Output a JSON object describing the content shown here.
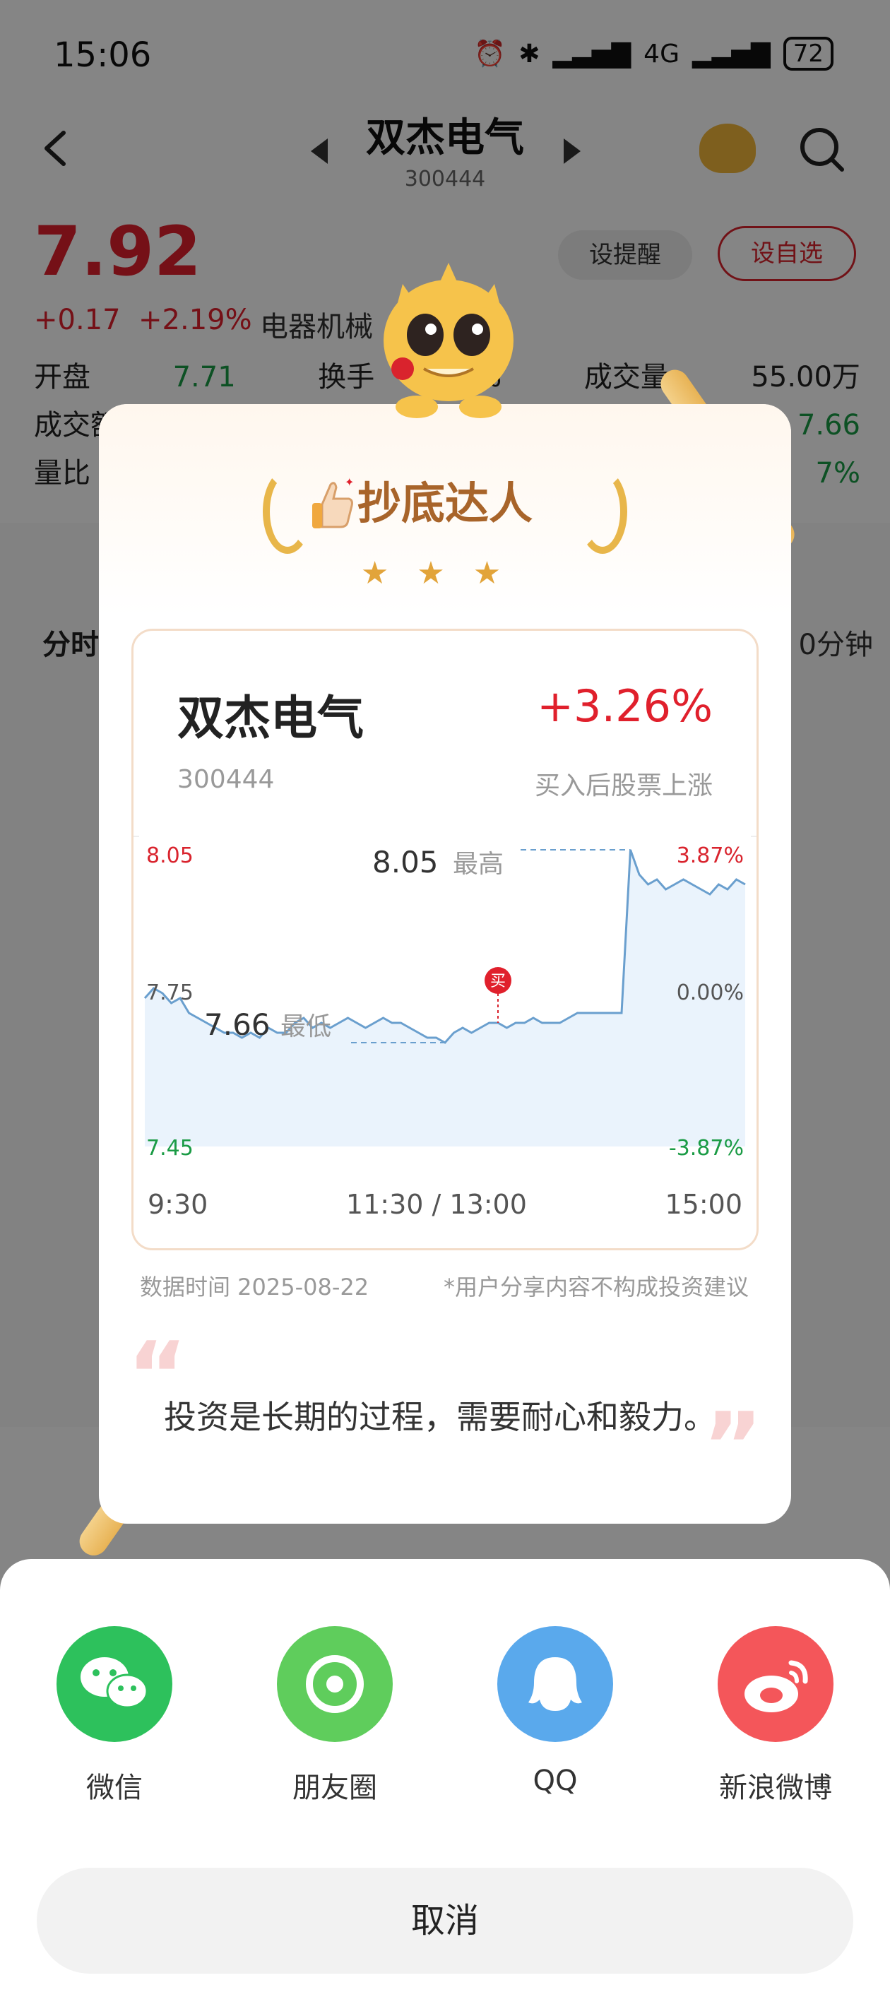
{
  "status_bar": {
    "time": "15:06",
    "network": "4G",
    "battery": "72"
  },
  "header": {
    "title": "双杰电气",
    "code": "300444"
  },
  "quote": {
    "price": "7.92",
    "change": "+0.17",
    "change_pct": "+2.19%",
    "industry": "电器机械",
    "alert_button": "设提醒",
    "favorite_button": "设自选"
  },
  "stats": {
    "row1": {
      "label1": "开盘",
      "value1": "7.71",
      "label2": "换手",
      "value2": "9%",
      "label3": "成交量",
      "value3": "55.00万"
    },
    "row2": {
      "label1": "成交额",
      "value_right": "7.66"
    },
    "row3": {
      "label1": "量比",
      "value_right": "7%"
    }
  },
  "background_tabs": {
    "left": "分时",
    "right": "0分钟"
  },
  "share_card": {
    "award_title": "抄底达人",
    "stock_name": "双杰电气",
    "stock_code": "300444",
    "change_pct": "+3.26%",
    "note": "买入后股票上涨",
    "data_date": "数据时间 2025-08-22",
    "disclaimer": "*用户分享内容不构成投资建议",
    "quote_text": "投资是长期的过程，需要耐心和毅力。"
  },
  "chart_data": {
    "type": "line",
    "price_axis_labels": {
      "top": "8.05",
      "mid": "7.75",
      "bottom": "7.45"
    },
    "pct_axis_labels": {
      "top": "3.87%",
      "mid": "0.00%",
      "bottom": "-3.87%"
    },
    "x_labels": [
      "9:30",
      "11:30 / 13:00",
      "15:00"
    ],
    "high": {
      "value": "8.05",
      "label": "最高"
    },
    "low": {
      "value": "7.66",
      "label": "最低"
    },
    "buy_marker": "买",
    "ylim": [
      7.45,
      8.05
    ],
    "series": [
      {
        "values": [
          7.75,
          7.77,
          7.76,
          7.74,
          7.75,
          7.72,
          7.71,
          7.7,
          7.69,
          7.68,
          7.68,
          7.67,
          7.68,
          7.67,
          7.69,
          7.68,
          7.68,
          7.7,
          7.71,
          7.69,
          7.7,
          7.69,
          7.7,
          7.71,
          7.7,
          7.69,
          7.7,
          7.71,
          7.7,
          7.7,
          7.69,
          7.68,
          7.67,
          7.67,
          7.66,
          7.68,
          7.69,
          7.68,
          7.69,
          7.7,
          7.7,
          7.69,
          7.7,
          7.7,
          7.71,
          7.7,
          7.7,
          7.7,
          7.71,
          7.72,
          7.72,
          7.72,
          7.72,
          7.72,
          7.72,
          8.05,
          8.0,
          7.98,
          7.99,
          7.97,
          7.98,
          7.99,
          7.98,
          7.97,
          7.96,
          7.98,
          7.97,
          7.99,
          7.98
        ]
      }
    ]
  },
  "share_sheet": {
    "options": [
      {
        "label": "微信",
        "color": "#2dc15c",
        "icon": "wechat-icon"
      },
      {
        "label": "朋友圈",
        "color": "#5fcd5c",
        "icon": "moments-icon"
      },
      {
        "label": "QQ",
        "color": "#5aa9ec",
        "icon": "qq-icon"
      },
      {
        "label": "新浪微博",
        "color": "#f4565a",
        "icon": "weibo-icon"
      }
    ],
    "cancel": "取消"
  }
}
